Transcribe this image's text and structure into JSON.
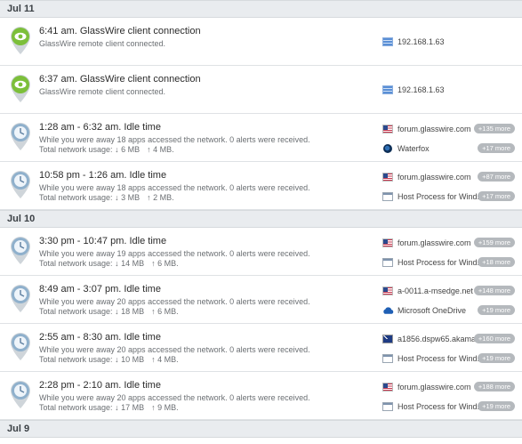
{
  "days": [
    {
      "date": "Jul 11",
      "events": [
        {
          "kind": "conn",
          "title": "6:41 am. GlassWire client connection",
          "subtitle": "GlassWire remote client connected.",
          "rows": [
            {
              "icon": "lan-icon",
              "text": "192.168.1.63"
            }
          ]
        },
        {
          "kind": "conn",
          "title": "6:37 am. GlassWire client connection",
          "subtitle": "GlassWire remote client connected.",
          "rows": [
            {
              "icon": "lan-icon",
              "text": "192.168.1.63"
            }
          ]
        },
        {
          "kind": "idle",
          "title": "1:28 am - 6:32 am. Idle time",
          "subtitle": "While you were away 18 apps accessed the network. 0 alerts were received.",
          "usage_label": "Total network usage:",
          "down": "↓ 6 MB",
          "up": "↑ 4 MB.",
          "rows": [
            {
              "icon": "us-flag-icon",
              "text": "forum.glasswire.com",
              "more": "+135 more"
            },
            {
              "icon": "waterfox-icon",
              "text": "Waterfox",
              "more": "+17 more"
            }
          ]
        },
        {
          "kind": "idle",
          "title": "10:58 pm - 1:26 am. Idle time",
          "subtitle": "While you were away 18 apps accessed the network. 0 alerts were received.",
          "usage_label": "Total network usage:",
          "down": "↓ 3 MB",
          "up": "↑ 2 MB.",
          "rows": [
            {
              "icon": "us-flag-icon",
              "text": "forum.glasswire.com",
              "more": "+87 more"
            },
            {
              "icon": "window-icon",
              "text": "Host Process for Wind...",
              "more": "+17 more"
            }
          ]
        }
      ]
    },
    {
      "date": "Jul 10",
      "events": [
        {
          "kind": "idle",
          "title": "3:30 pm - 10:47 pm. Idle time",
          "subtitle": "While you were away 19 apps accessed the network. 0 alerts were received.",
          "usage_label": "Total network usage:",
          "down": "↓ 14 MB",
          "up": "↑ 6 MB.",
          "rows": [
            {
              "icon": "us-flag-icon",
              "text": "forum.glasswire.com",
              "more": "+159 more"
            },
            {
              "icon": "window-icon",
              "text": "Host Process for Wind...",
              "more": "+18 more"
            }
          ]
        },
        {
          "kind": "idle",
          "title": "8:49 am - 3:07 pm. Idle time",
          "subtitle": "While you were away 20 apps accessed the network. 0 alerts were received.",
          "usage_label": "Total network usage:",
          "down": "↓ 18 MB",
          "up": "↑ 6 MB.",
          "rows": [
            {
              "icon": "us-flag-icon",
              "text": "a-0011.a-msedge.net",
              "more": "+148 more"
            },
            {
              "icon": "onedrive-icon",
              "text": "Microsoft OneDrive",
              "more": "+19 more"
            }
          ]
        },
        {
          "kind": "idle",
          "title": "2:55 am - 8:30 am. Idle time",
          "subtitle": "While you were away 20 apps accessed the network. 0 alerts were received.",
          "usage_label": "Total network usage:",
          "down": "↓ 10 MB",
          "up": "↑ 4 MB.",
          "rows": [
            {
              "icon": "au-flag-icon",
              "text": "a1856.dspw65.akamai...",
              "more": "+160 more"
            },
            {
              "icon": "window-icon",
              "text": "Host Process for Wind...",
              "more": "+19 more"
            }
          ]
        },
        {
          "kind": "idle",
          "title": "2:28 pm - 2:10 am. Idle time",
          "subtitle": "While you were away 20 apps accessed the network. 0 alerts were received.",
          "usage_label": "Total network usage:",
          "down": "↓ 17 MB",
          "up": "↑ 9 MB.",
          "rows": [
            {
              "icon": "us-flag-icon",
              "text": "forum.glasswire.com",
              "more": "+188 more"
            },
            {
              "icon": "window-icon",
              "text": "Host Process for Wind...",
              "more": "+19 more"
            }
          ]
        }
      ]
    },
    {
      "date": "Jul 9",
      "events": []
    }
  ],
  "colors": {
    "conn_pin": "#7cbf3a",
    "idle_pin": "#8fb0cc",
    "more_badge": "#b5b9bd"
  }
}
